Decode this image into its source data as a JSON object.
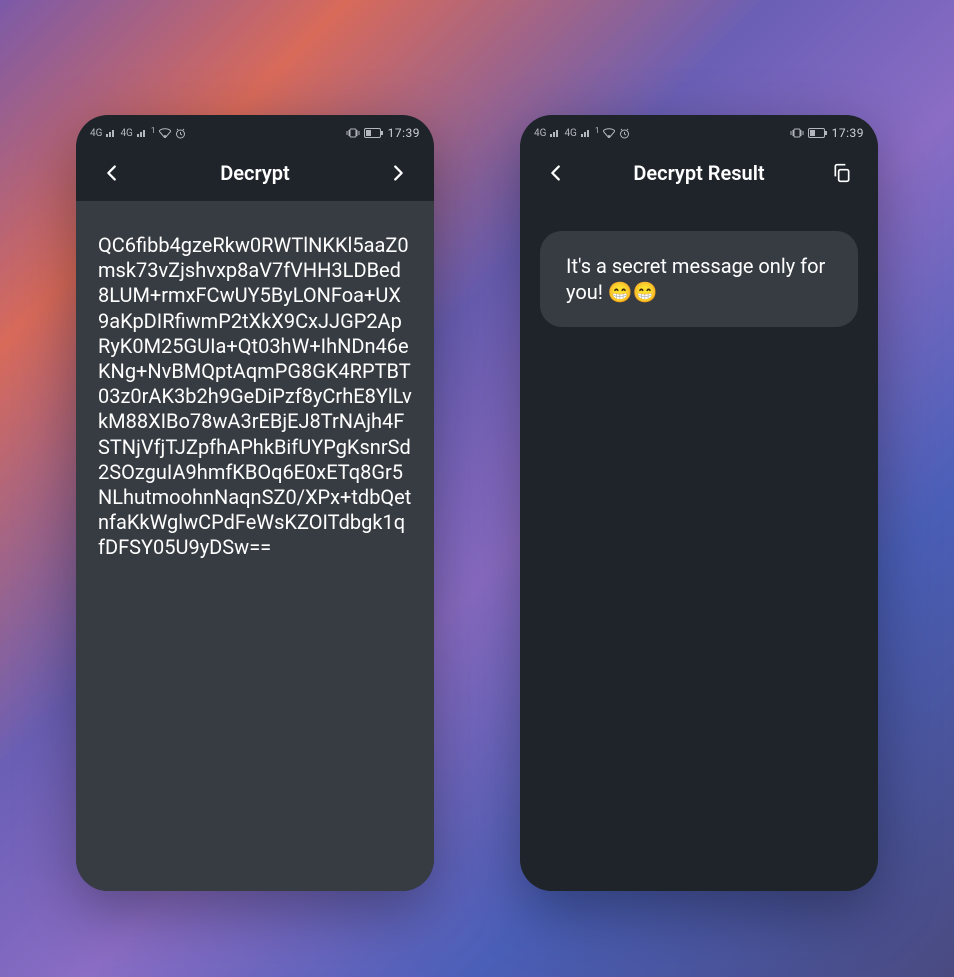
{
  "status": {
    "time": "17:39",
    "signal1_label": "4G",
    "signal2_label": "4G",
    "superscript": "1"
  },
  "left": {
    "title": "Decrypt",
    "ciphertext": "QC6fibb4gzeRkw0RWTlNKKl5aaZ0msk73vZjshvxp8aV7fVHH3LDBed8LUM+rmxFCwUY5ByLONFoa+UX9aKpDIRfiwmP2tXkX9CxJJGP2ApRyK0M25GUIa+Qt03hW+IhNDn46eKNg+NvBMQptAqmPG8GK4RPTBT03z0rAK3b2h9GeDiPzf8yCrhE8YlLvkM88XIBo78wA3rEBjEJ8TrNAjh4FSTNjVfjTJZpfhAPhkBifUYPgKsnrSd2SOzguIA9hmfKBOq6E0xETq8Gr5NLhutmoohnNaqnSZ0/XPx+tdbQetnfaKkWglwCPdFeWsKZOITdbgk1qfDFSY05U9yDSw=="
  },
  "right": {
    "title": "Decrypt Result",
    "message": "It's a secret message only for you! 😁😁"
  }
}
